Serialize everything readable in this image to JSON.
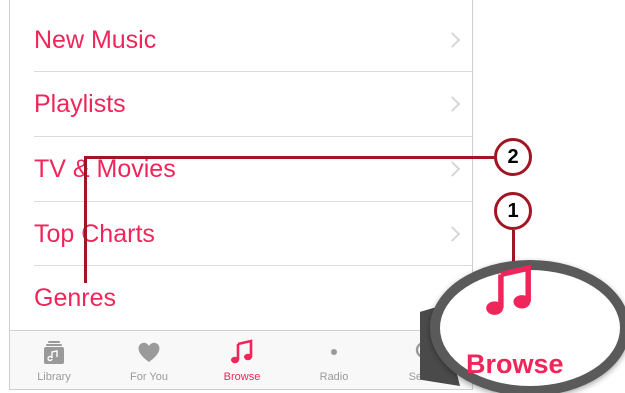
{
  "list": {
    "items": [
      {
        "label": "New Music"
      },
      {
        "label": "Playlists"
      },
      {
        "label": "TV & Movies"
      },
      {
        "label": "Top Charts"
      },
      {
        "label": "Genres"
      }
    ]
  },
  "tabbar": {
    "tabs": [
      {
        "label": "Library",
        "icon": "library-icon"
      },
      {
        "label": "For You",
        "icon": "heart-icon"
      },
      {
        "label": "Browse",
        "icon": "music-note-icon",
        "active": true
      },
      {
        "label": "Radio",
        "icon": "radio-icon"
      },
      {
        "label": "Search",
        "icon": "search-icon"
      }
    ]
  },
  "callouts": {
    "one": "1",
    "two": "2",
    "zoom_label": "Browse"
  },
  "colors": {
    "accent": "#f0255a",
    "callout": "#a01622",
    "inactive": "#9a9a9a"
  }
}
